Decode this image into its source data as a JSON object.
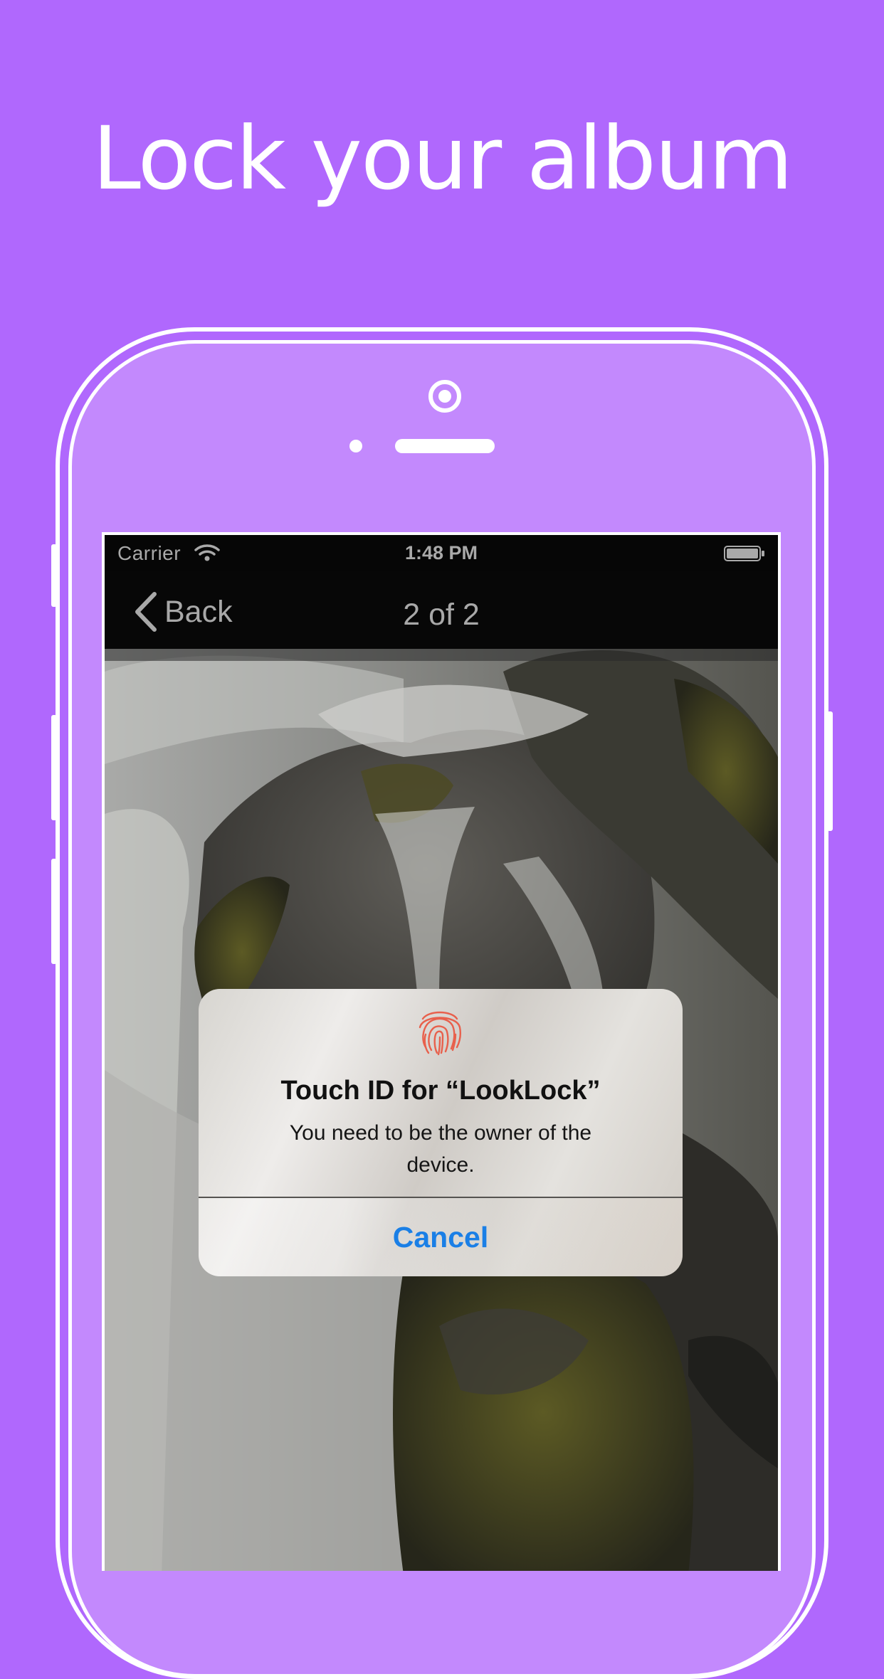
{
  "headline": "Lock your album",
  "status_bar": {
    "carrier": "Carrier",
    "time": "1:48 PM",
    "wifi_icon": "wifi-icon",
    "battery_icon": "battery-icon"
  },
  "nav": {
    "back_label": "Back",
    "title": "2 of 2",
    "back_icon": "chevron-left-icon"
  },
  "alert": {
    "icon": "fingerprint-icon",
    "title": "Touch ID for “LookLock”",
    "message": "You need to be the owner of the device.",
    "cancel_label": "Cancel"
  },
  "colors": {
    "background": "#b068fd",
    "phone_body": "#c389fd",
    "frame": "#ffffff",
    "alert_button": "#1a7fe6",
    "fingerprint": "#e8604c"
  }
}
